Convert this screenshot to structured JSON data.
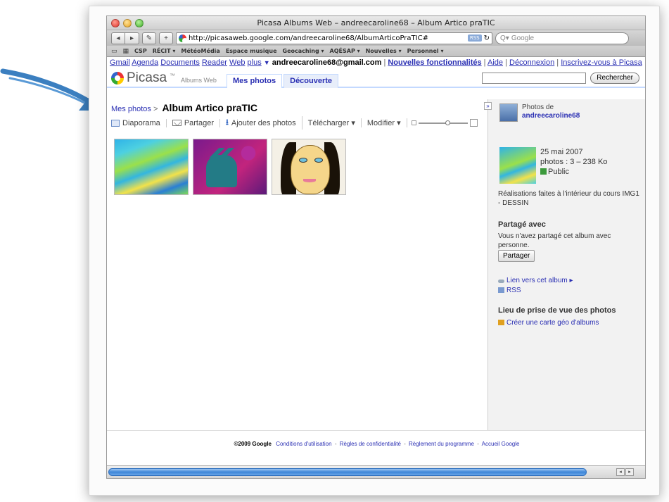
{
  "window": {
    "title": "Picasa Albums Web – andreecaroline68 – Album Artico praTIC"
  },
  "toolbar": {
    "back": "◂",
    "forward": "▸",
    "edit": "✎",
    "add": "+",
    "url": "http://picasaweb.google.com/andreecaroline68/AlbumArticoPraTIC#",
    "rss": "RSS",
    "reload": "↻",
    "search_placeholder": "Google"
  },
  "bookmarks": [
    "CSP",
    "RÉCIT ▾",
    "MétéoMédia",
    "Espace musique",
    "Geocaching ▾",
    "AQÉSAP ▾",
    "Nouvelles ▾",
    "Personnel ▾"
  ],
  "gbar": {
    "links": [
      "Gmail",
      "Agenda",
      "Documents",
      "Reader",
      "Web",
      "plus"
    ],
    "more_arrow": "▼",
    "user": "andreecaroline68@gmail.com",
    "right": [
      "Nouvelles fonctionnalités",
      "Aide",
      "Déconnexion",
      "Inscrivez-vous à Picasa"
    ]
  },
  "header": {
    "logo": "Picasa",
    "logo_tm": "™",
    "logo_sub": "Albums Web",
    "tabs": [
      "Mes photos",
      "Découverte"
    ],
    "search_button": "Rechercher"
  },
  "main": {
    "breadcrumb_root": "Mes photos",
    "breadcrumb_sep": ">",
    "album_title": "Album Artico praTIC",
    "actions": [
      "Diaporama",
      "Partager",
      "Ajouter des photos",
      "Télécharger ▾",
      "Modifier ▾"
    ]
  },
  "sidebar": {
    "collapse": "»",
    "owner_label": "Photos de",
    "owner_name": "andreecaroline68",
    "date": "25 mai 2007",
    "photos": "photos : 3 – 238 Ko",
    "visibility": "Public",
    "description": "Réalisations faites à l'intérieur du cours IMG1 - DESSIN",
    "shared_title": "Partagé avec",
    "shared_text": "Vous n'avez partagé cet album avec personne.",
    "share_button": "Partager",
    "link_album": "Lien vers cet album ▸",
    "rss": "RSS",
    "location_title": "Lieu de prise de vue des photos",
    "geo_link": "Créer une carte géo d'albums"
  },
  "footer": {
    "copyright": "©2009 Google",
    "links": [
      "Conditions d'utilisation",
      "Règles de confidentialité",
      "Règlement du programme",
      "Accueil Google"
    ]
  },
  "colors": {
    "link": "#2a2fb3",
    "arrow": "#3b7fc0",
    "scroll_thumb": "#3d86d8"
  }
}
